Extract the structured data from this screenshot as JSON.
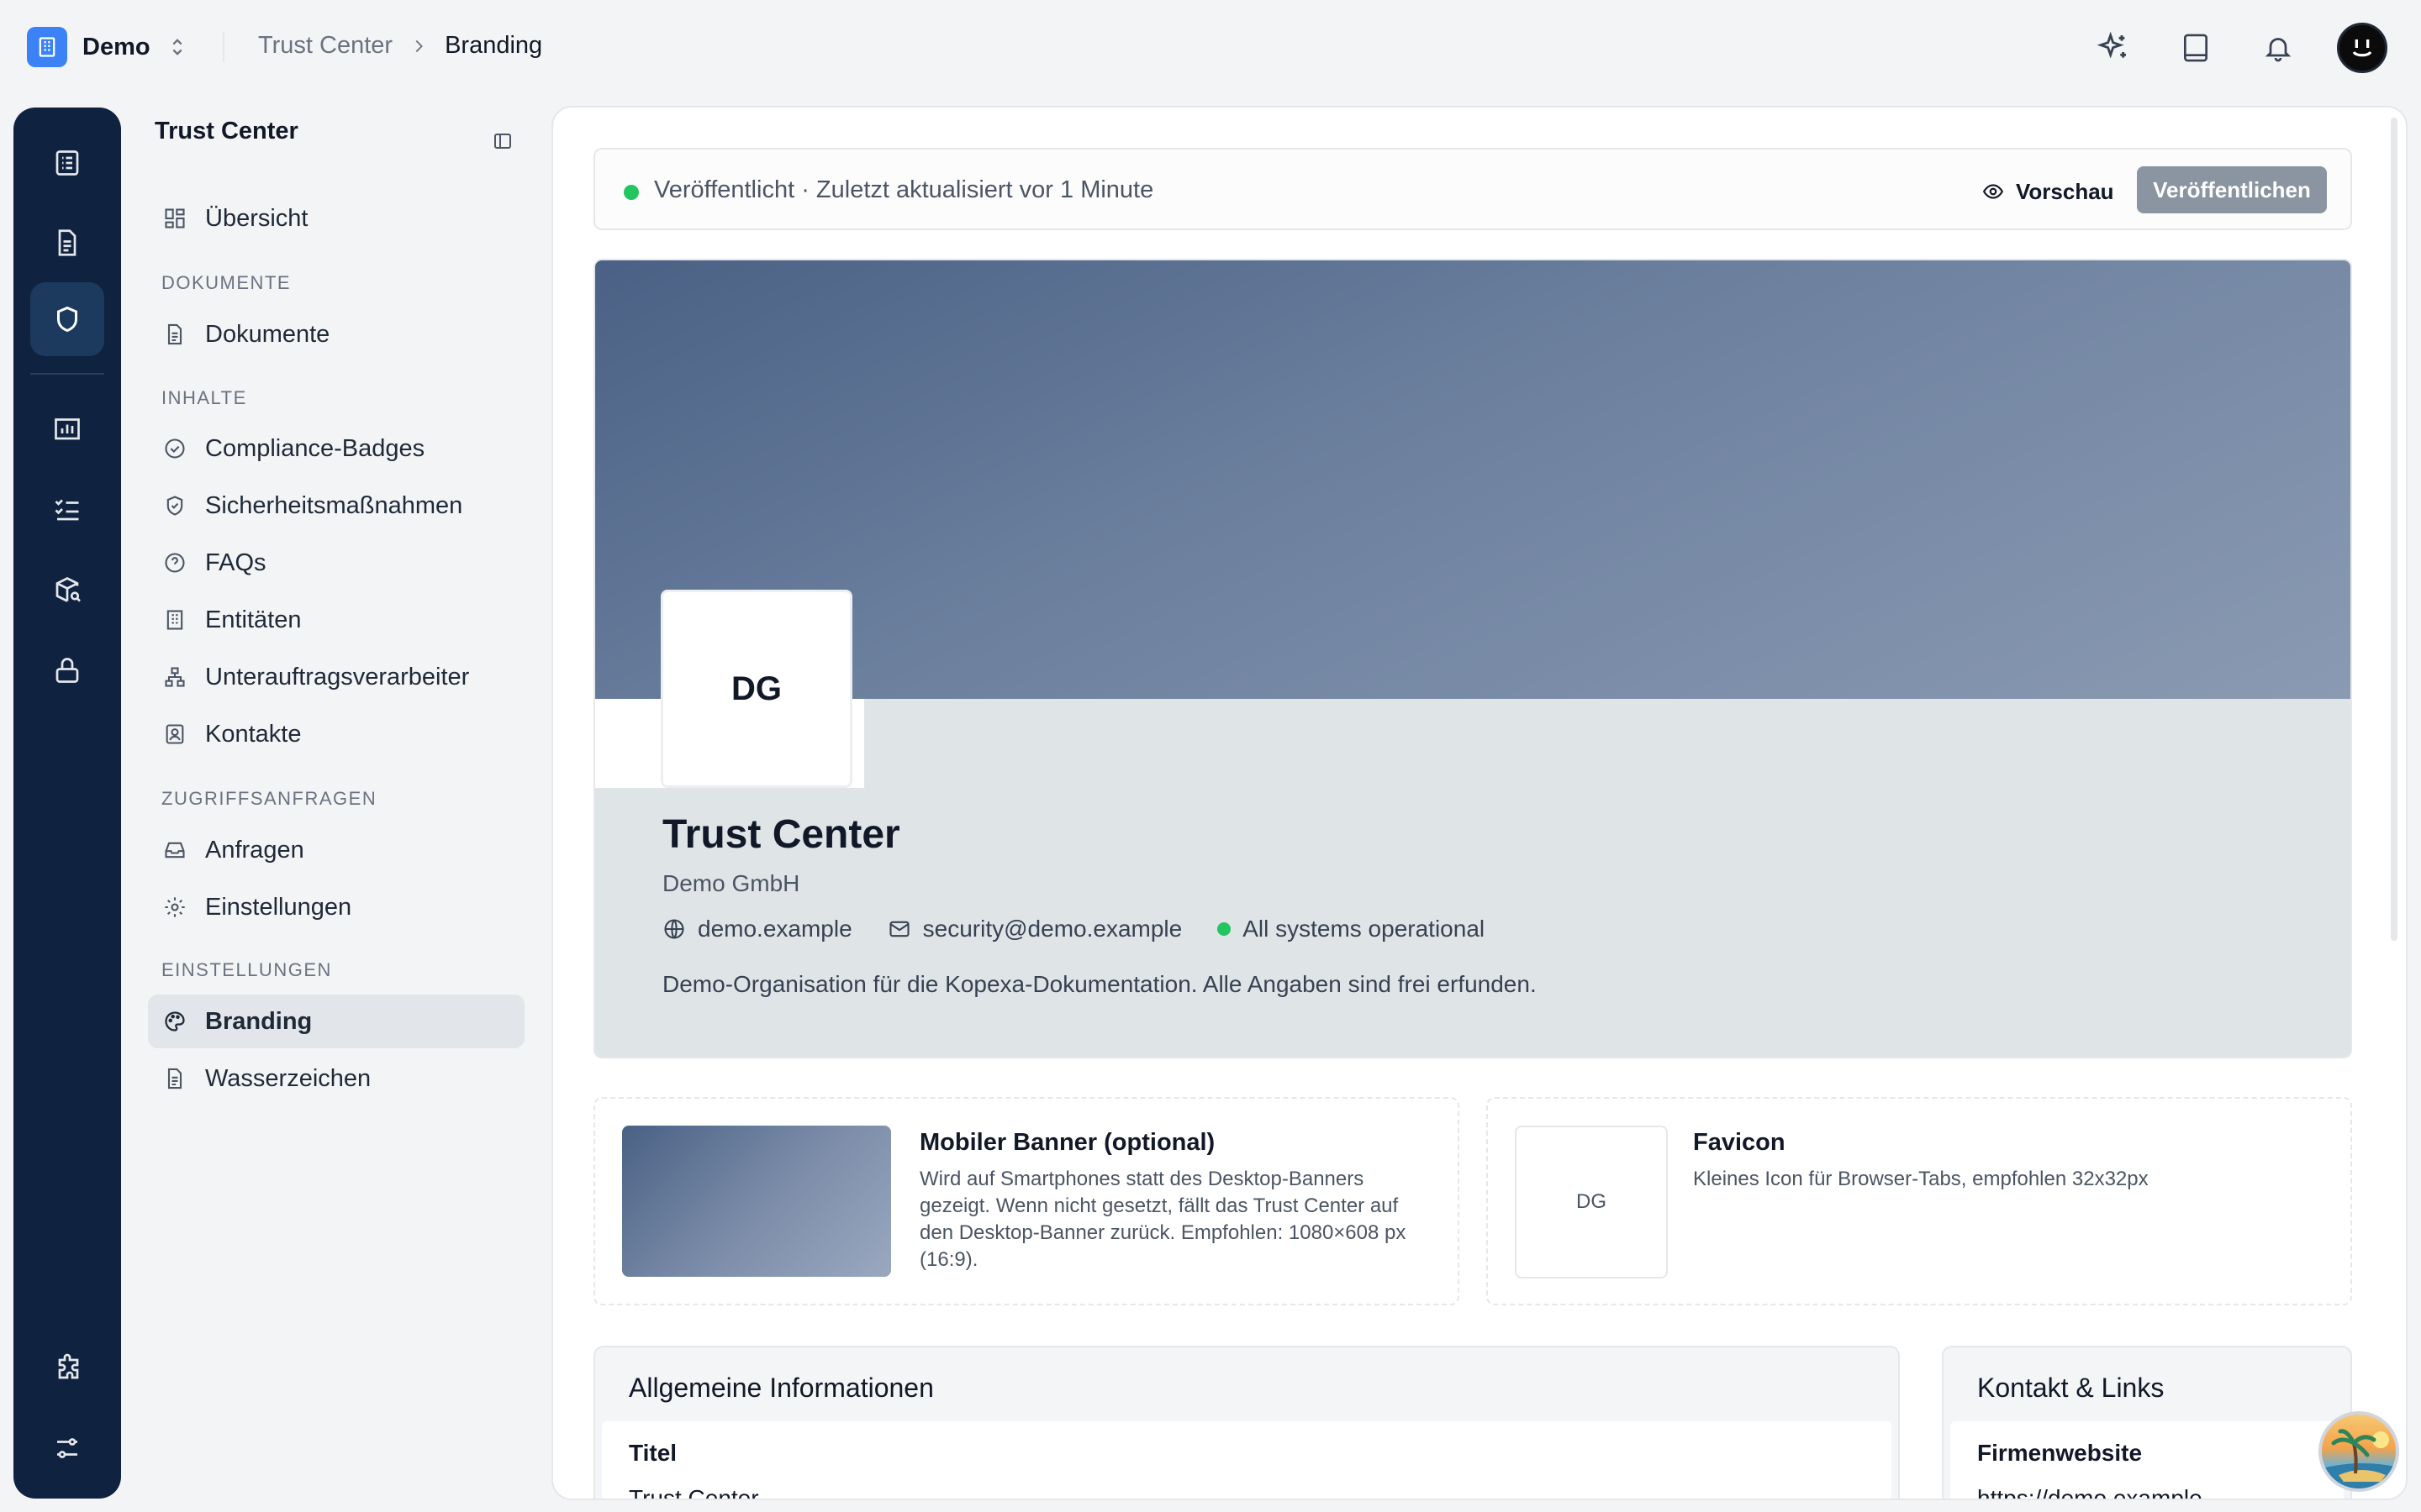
{
  "topbar": {
    "org_name": "Demo",
    "breadcrumb_parent": "Trust Center",
    "breadcrumb_current": "Branding",
    "icons": [
      "sparkles-icon",
      "book-icon",
      "bell-icon",
      "user-avatar"
    ]
  },
  "rail": {
    "items": [
      "checklist-icon",
      "document-icon",
      "shield-icon",
      "chart-icon",
      "list-check-icon",
      "package-search-icon",
      "lock-icon",
      "puzzle-icon",
      "sliders-icon"
    ],
    "active": "shield-icon"
  },
  "sidebar": {
    "title": "Trust Center",
    "overview": "Übersicht",
    "sections": {
      "documents": "DOKUMENTE",
      "content": "INHALTE",
      "access": "ZUGRIFFSANFRAGEN",
      "settings": "EINSTELLUNGEN"
    },
    "items": {
      "documents": "Dokumente",
      "badges": "Compliance-Badges",
      "security": "Sicherheitsmaßnahmen",
      "faqs": "FAQs",
      "entities": "Entitäten",
      "subprocessors": "Unterauftragsverarbeiter",
      "contacts": "Kontakte",
      "requests": "Anfragen",
      "access_settings": "Einstellungen",
      "branding": "Branding",
      "watermark": "Wasserzeichen"
    }
  },
  "status": {
    "text": "Veröffentlicht · Zuletzt aktualisiert vor 1 Minute",
    "preview_label": "Vorschau",
    "publish_label": "Veröffentlichen",
    "color": "#22c55e"
  },
  "hero": {
    "logo_initials": "DG",
    "title": "Trust Center",
    "company": "Demo GmbH",
    "website": "demo.example",
    "email": "security@demo.example",
    "system_status": "All systems operational",
    "description": "Demo-Organisation für die Kopexa-Dokumentation. Alle Angaben sind frei erfunden."
  },
  "mobile_banner": {
    "title": "Mobiler Banner (optional)",
    "description": "Wird auf Smartphones statt des Desktop-Banners gezeigt. Wenn nicht gesetzt, fällt das Trust Center auf den Desktop-Banner zurück. Empfohlen: 1080×608 px (16:9)."
  },
  "favicon": {
    "title": "Favicon",
    "description": "Kleines Icon für Browser-Tabs, empfohlen 32x32px",
    "initials": "DG"
  },
  "general": {
    "title": "Allgemeine Informationen",
    "field_label": "Titel",
    "field_value": "Trust Center"
  },
  "contact": {
    "title": "Kontakt & Links",
    "field_label": "Firmenwebsite",
    "field_value": "https://demo.example"
  },
  "colors": {
    "accent": "#3b82f6",
    "rail": "#0f2240",
    "status_ok": "#22c55e"
  }
}
